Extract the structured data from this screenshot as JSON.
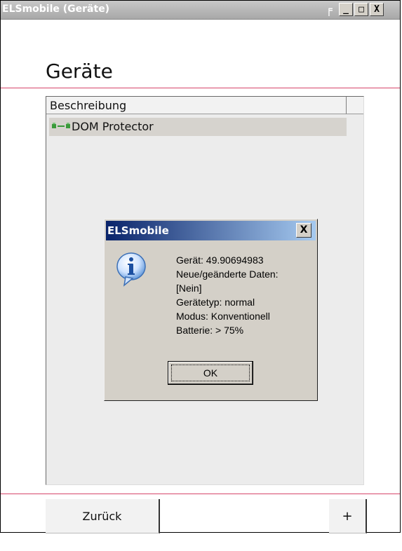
{
  "window": {
    "title": "ELSmobile (Geräte)",
    "controls": {
      "flag": "F",
      "minimize": "_",
      "maximize": "□",
      "close": "X"
    }
  },
  "page": {
    "title": "Geräte"
  },
  "list": {
    "header": "Beschreibung",
    "rows": [
      {
        "label": "DOM Protector",
        "icon": "device-link-icon"
      }
    ]
  },
  "dialog": {
    "title": "ELSmobile",
    "close": "X",
    "icon": "info-icon",
    "lines": [
      "Gerät: 49.90694983",
      "Neue/geänderte Daten:",
      "[Nein]",
      "Gerätetyp: normal",
      "Modus: Konventionell",
      "Batterie: > 75%"
    ],
    "ok": "OK"
  },
  "footer": {
    "back": "Zurück",
    "add": "+"
  },
  "colors": {
    "accent_line": "#d7456a",
    "dialog_title": "#0a246a"
  }
}
